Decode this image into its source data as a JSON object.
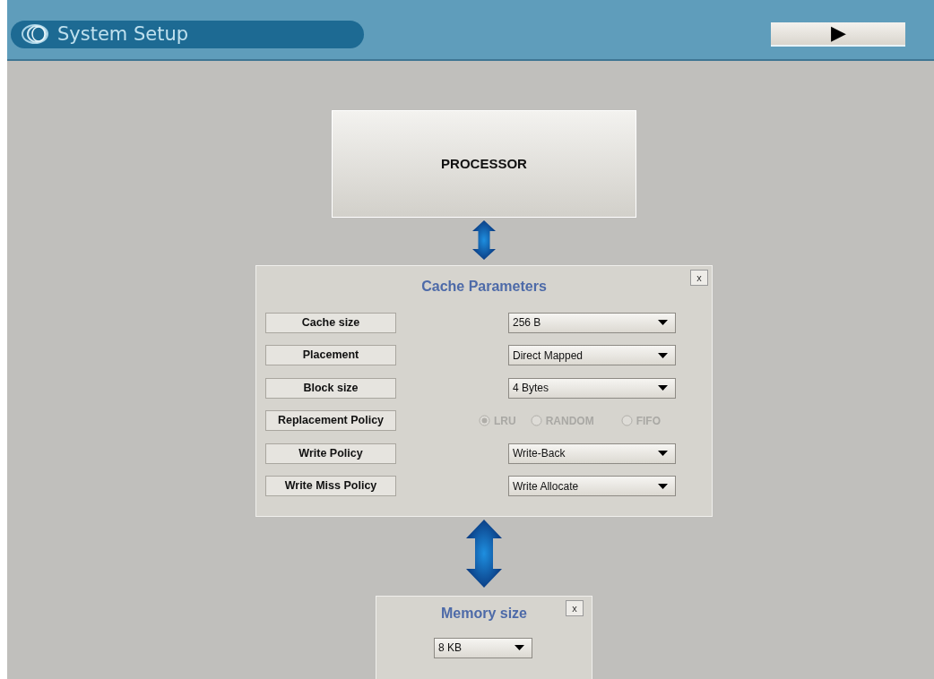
{
  "header": {
    "title": "System Setup",
    "play_button": "▶"
  },
  "processor": {
    "label": "PROCESSOR"
  },
  "cache_panel": {
    "title": "Cache Parameters",
    "close": "x",
    "rows": [
      {
        "kind": "dropdown",
        "label": "Cache size",
        "value": "256 B"
      },
      {
        "kind": "dropdown",
        "label": "Placement",
        "value": "Direct Mapped"
      },
      {
        "kind": "dropdown",
        "label": "Block size",
        "value": "4 Bytes"
      },
      {
        "kind": "radio",
        "label": "Replacement Policy",
        "disabled": true,
        "options": [
          {
            "label": "LRU",
            "selected": true
          },
          {
            "label": "RANDOM",
            "selected": false
          },
          {
            "label": "FIFO",
            "selected": false
          }
        ]
      },
      {
        "kind": "dropdown",
        "label": "Write Policy",
        "value": "Write-Back"
      },
      {
        "kind": "dropdown",
        "label": "Write Miss Policy",
        "value": "Write Allocate"
      }
    ]
  },
  "memory_panel": {
    "title": "Memory size",
    "close": "x",
    "value": "8 KB"
  }
}
